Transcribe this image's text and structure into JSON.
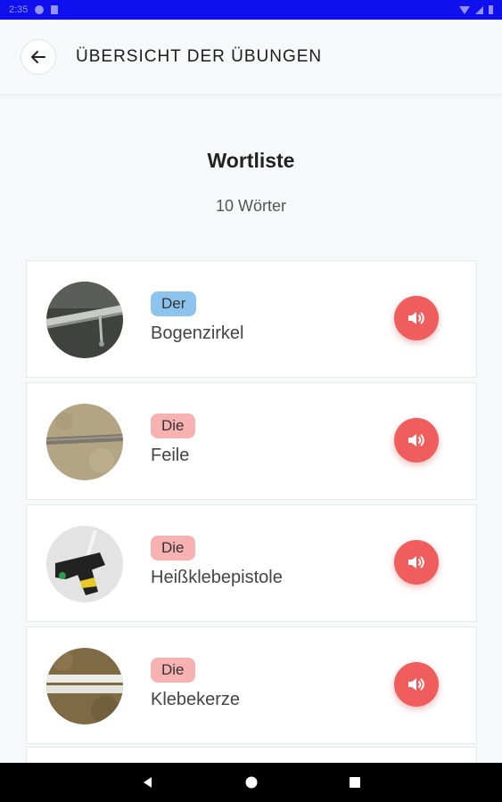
{
  "status_bar": {
    "time": "2:35"
  },
  "header": {
    "title": "ÜBERSICHT DER ÜBUNGEN"
  },
  "word_list": {
    "title": "Wortliste",
    "count": "10 Wörter"
  },
  "words": [
    {
      "article": "Der",
      "word": "Bogenzirkel",
      "article_color": "#8cc4ee"
    },
    {
      "article": "Die",
      "word": "Feile",
      "article_color": "#f8b1b1"
    },
    {
      "article": "Die",
      "word": "Heißklebepistole",
      "article_color": "#f8b1b1"
    },
    {
      "article": "Die",
      "word": "Klebekerze",
      "article_color": "#f8b1b1"
    }
  ],
  "colors": {
    "accent": "#ef5d5d",
    "status_bar": "#1010ee",
    "der_badge": "#8cc4ee",
    "die_badge": "#f8b1b1"
  }
}
